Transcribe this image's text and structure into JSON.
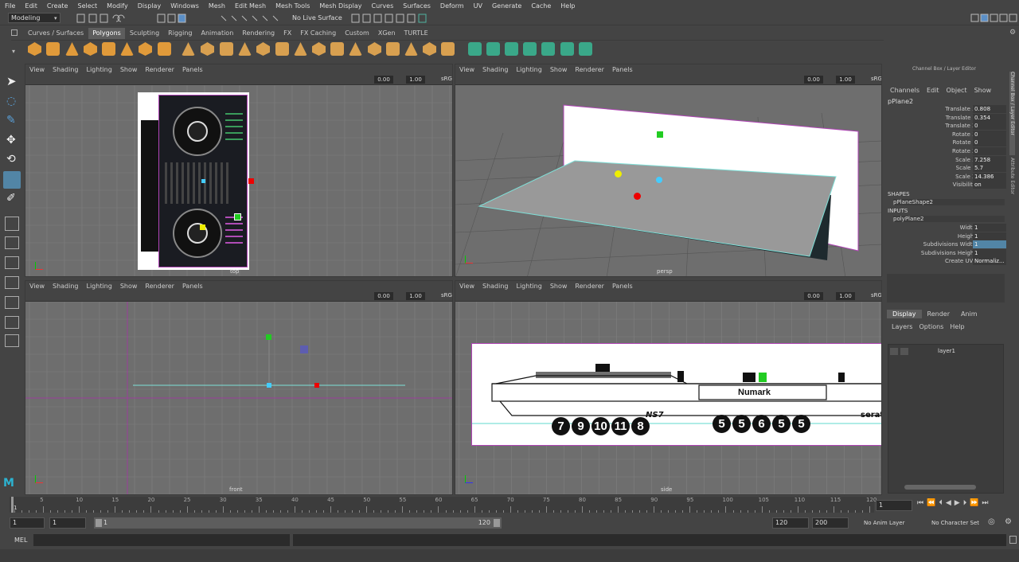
{
  "menubar": [
    "File",
    "Edit",
    "Create",
    "Select",
    "Modify",
    "Display",
    "Windows",
    "Mesh",
    "Edit Mesh",
    "Mesh Tools",
    "Mesh Display",
    "Curves",
    "Surfaces",
    "Deform",
    "UV",
    "Generate",
    "Cache",
    "Help"
  ],
  "status": {
    "mode": "Modeling",
    "live_surface": "No Live Surface"
  },
  "shelf_tabs": [
    "Curves / Surfaces",
    "Polygons",
    "Sculpting",
    "Rigging",
    "Animation",
    "Rendering",
    "FX",
    "FX Caching",
    "Custom",
    "XGen",
    "TURTLE"
  ],
  "shelf_active": "Polygons",
  "viewport_menu": [
    "View",
    "Shading",
    "Lighting",
    "Show",
    "Renderer",
    "Panels"
  ],
  "viewports": {
    "top": {
      "label": "top",
      "near": "0.00",
      "far": "1.00",
      "cs": "sRG"
    },
    "persp": {
      "label": "persp",
      "near": "0.00",
      "far": "1.00",
      "cs": "sRG"
    },
    "front": {
      "label": "front",
      "near": "0.00",
      "far": "1.00",
      "cs": "sRG"
    },
    "side": {
      "label": "side",
      "near": "0.00",
      "far": "1.00",
      "cs": "sRG"
    }
  },
  "side_view": {
    "brand": "Numark",
    "model": "NS7",
    "logo": "serato",
    "numbers_left": [
      "7",
      "9",
      "10",
      "11",
      "8"
    ],
    "numbers_right": [
      "5",
      "5",
      "6",
      "5",
      "5"
    ]
  },
  "channel_box": {
    "title": "Channel Box / Layer Editor",
    "menu": [
      "Channels",
      "Edit",
      "Object",
      "Show"
    ],
    "object": "pPlane2",
    "attrs": [
      {
        "label": "Translate X",
        "value": "0.808"
      },
      {
        "label": "Translate Y",
        "value": "0.354"
      },
      {
        "label": "Translate Z",
        "value": "0"
      },
      {
        "label": "Rotate X",
        "value": "0"
      },
      {
        "label": "Rotate Y",
        "value": "0"
      },
      {
        "label": "Rotate Z",
        "value": "0"
      },
      {
        "label": "Scale X",
        "value": "7.258"
      },
      {
        "label": "Scale Y",
        "value": "5.7"
      },
      {
        "label": "Scale Z",
        "value": "14.386"
      },
      {
        "label": "Visibility",
        "value": "on"
      }
    ],
    "shapes_header": "SHAPES",
    "shape": "pPlaneShape2",
    "inputs_header": "INPUTS",
    "input": "polyPlane2",
    "input_attrs": [
      {
        "label": "Width",
        "value": "1"
      },
      {
        "label": "Height",
        "value": "1"
      },
      {
        "label": "Subdivisions Width",
        "value": "1"
      },
      {
        "label": "Subdivisions Height",
        "value": "1"
      },
      {
        "label": "Create UVs",
        "value": "Normaliz..."
      }
    ]
  },
  "layer_editor": {
    "tabs": [
      "Display",
      "Render",
      "Anim"
    ],
    "menu": [
      "Layers",
      "Options",
      "Help"
    ],
    "layer": "layer1"
  },
  "side_tabs": [
    "Channel Box / Layer Editor",
    "Attribute Editor"
  ],
  "timeline": {
    "ticks": [
      "5",
      "10",
      "15",
      "20",
      "25",
      "30",
      "35",
      "40",
      "45",
      "50",
      "55",
      "60",
      "65",
      "70",
      "75",
      "80",
      "85",
      "90",
      "95",
      "100",
      "105",
      "110",
      "115",
      "120"
    ],
    "first": "1",
    "current": "1"
  },
  "range": {
    "start": "1",
    "start2": "1",
    "slider_start": "1",
    "slider_end": "120",
    "end": "120",
    "end2": "200",
    "anim_layer": "No Anim Layer",
    "char_set": "No Character Set"
  },
  "cmd": {
    "label": "MEL"
  }
}
